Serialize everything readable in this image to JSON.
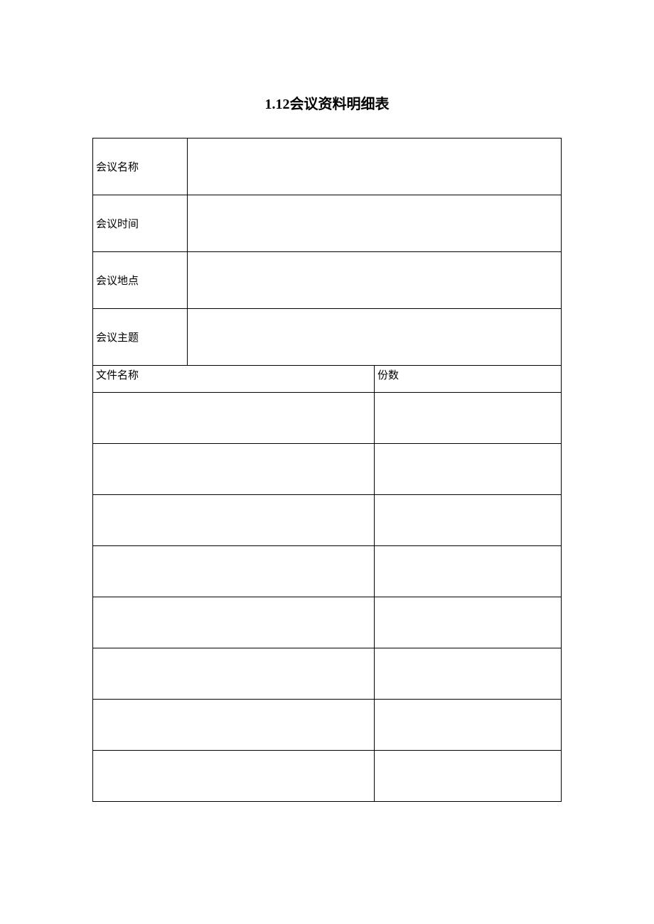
{
  "title": "1.12会议资料明细表",
  "info": {
    "meeting_name_label": "会议名称",
    "meeting_name_value": "",
    "meeting_time_label": "会议时间",
    "meeting_time_value": "",
    "meeting_place_label": "会议地点",
    "meeting_place_value": "",
    "meeting_topic_label": "会议主题",
    "meeting_topic_value": ""
  },
  "columns": {
    "file_name": "文件名称",
    "copies": "份数"
  },
  "rows": [
    {
      "file_name": "",
      "copies": ""
    },
    {
      "file_name": "",
      "copies": ""
    },
    {
      "file_name": "",
      "copies": ""
    },
    {
      "file_name": "",
      "copies": ""
    },
    {
      "file_name": "",
      "copies": ""
    },
    {
      "file_name": "",
      "copies": ""
    },
    {
      "file_name": "",
      "copies": ""
    },
    {
      "file_name": "",
      "copies": ""
    }
  ]
}
